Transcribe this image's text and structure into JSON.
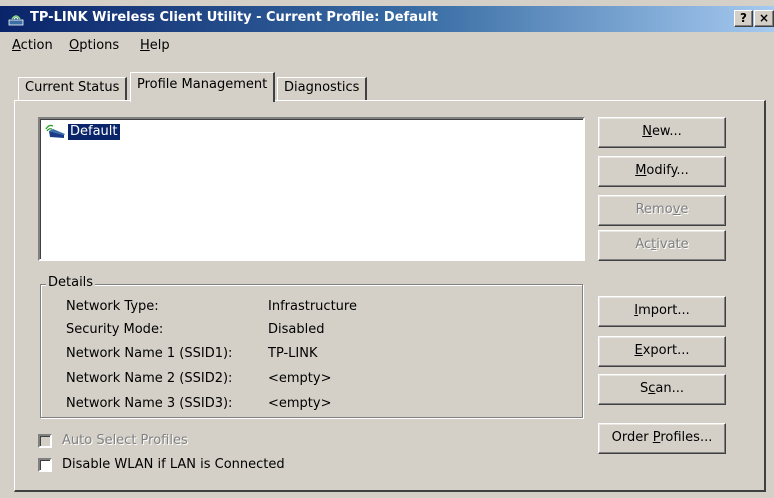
{
  "window": {
    "title": "TP-LINK Wireless Client Utility - Current Profile: Default",
    "help_button": "?",
    "close_button": "×"
  },
  "menu": [
    {
      "label_pre": "",
      "label_ul": "A",
      "label_post": "ction"
    },
    {
      "label_pre": "",
      "label_ul": "O",
      "label_post": "ptions"
    },
    {
      "label_pre": "",
      "label_ul": "H",
      "label_post": "elp"
    }
  ],
  "tabs": {
    "current_status": "Current Status",
    "profile_management": "Profile Management",
    "diagnostics": "Diagnostics",
    "active": "profile_management"
  },
  "profiles": [
    {
      "name": "Default",
      "selected": true
    }
  ],
  "buttons": {
    "new": {
      "pre": "",
      "ul": "N",
      "post": "ew..."
    },
    "modify": {
      "pre": "",
      "ul": "M",
      "post": "odify..."
    },
    "remove": {
      "pre": "Remo",
      "ul": "v",
      "post": "e",
      "enabled": false
    },
    "activate": {
      "pre": "Ac",
      "ul": "t",
      "post": "ivate",
      "enabled": false
    },
    "import": {
      "pre": "",
      "ul": "I",
      "post": "mport..."
    },
    "export": {
      "pre": "",
      "ul": "E",
      "post": "xport..."
    },
    "scan": {
      "pre": "S",
      "ul": "c",
      "post": "an..."
    },
    "order_profiles": {
      "pre": "Order ",
      "ul": "P",
      "post": "rofiles..."
    }
  },
  "details": {
    "title": "Details",
    "rows": [
      {
        "label": "Network Type:",
        "value": "Infrastructure"
      },
      {
        "label": "Security Mode:",
        "value": "Disabled"
      },
      {
        "label": "Network Name 1 (SSID1):",
        "value": "TP-LINK"
      },
      {
        "label": "Network Name 2 (SSID2):",
        "value": "<empty>"
      },
      {
        "label": "Network Name 3 (SSID3):",
        "value": "<empty>"
      }
    ]
  },
  "options": {
    "auto_select": {
      "label": "Auto Select Profiles",
      "checked": false,
      "enabled": false
    },
    "disable_wlan": {
      "label": "Disable WLAN if LAN is Connected",
      "checked": false,
      "enabled": true
    }
  },
  "colors": {
    "face": "#d4d0c8",
    "title_start": "#0a246a",
    "title_end": "#a6caf0",
    "selection": "#0a246a"
  }
}
